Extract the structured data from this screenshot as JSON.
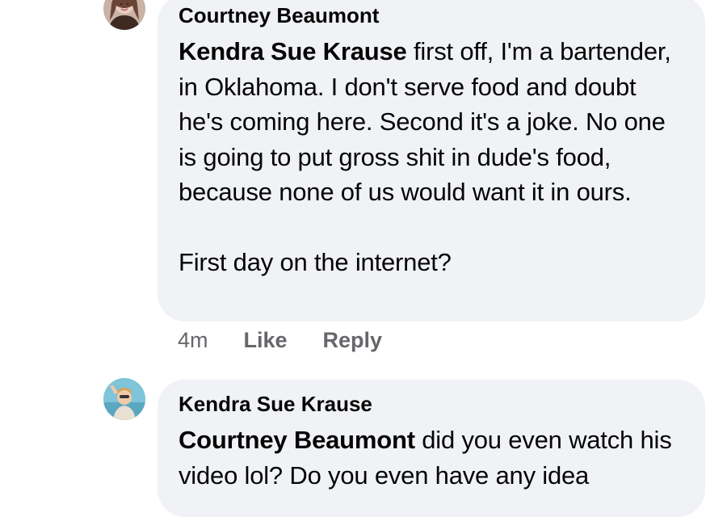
{
  "comments": [
    {
      "author": "Courtney Beaumont",
      "mention": "Kendra Sue Krause",
      "text": " first off, I'm a bartender, in Oklahoma. I don't serve food and doubt he's coming here. Second it's a joke. No one is going to put gross shit in dude's food, because none of us would want it in ours.\n\nFirst day on the internet?",
      "time": "4m",
      "like_label": "Like",
      "reply_label": "Reply",
      "avatar_icon": "profile-photo-woman"
    },
    {
      "author": "Kendra Sue Krause",
      "mention": "Courtney Beaumont",
      "text": " did you even watch his video lol? Do you even have any idea",
      "avatar_icon": "profile-photo-waving-person"
    }
  ],
  "colors": {
    "bubble_bg": "#f0f2f5",
    "text": "#050505",
    "meta": "#65676b"
  }
}
